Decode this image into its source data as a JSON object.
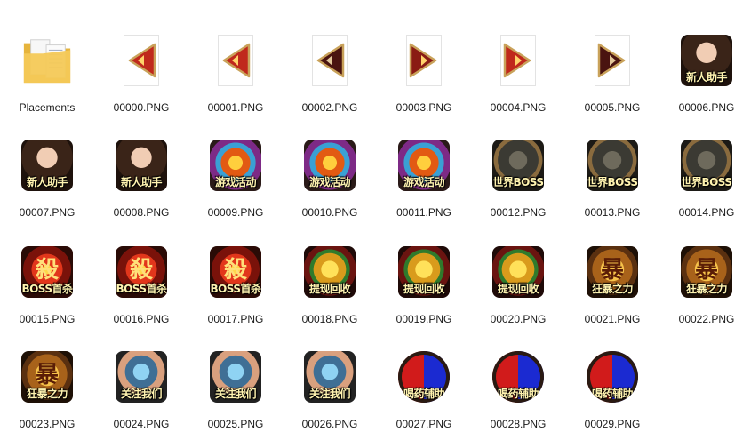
{
  "items": [
    {
      "name": "Placements",
      "kind": "folder"
    },
    {
      "name": "00000.PNG",
      "kind": "arrow",
      "dir": "left",
      "tone": "bright"
    },
    {
      "name": "00001.PNG",
      "kind": "arrow",
      "dir": "left",
      "tone": "bright"
    },
    {
      "name": "00002.PNG",
      "kind": "arrow",
      "dir": "left",
      "tone": "dark"
    },
    {
      "name": "00003.PNG",
      "kind": "arrow",
      "dir": "right",
      "tone": "mid"
    },
    {
      "name": "00004.PNG",
      "kind": "arrow",
      "dir": "right",
      "tone": "bright"
    },
    {
      "name": "00005.PNG",
      "kind": "arrow",
      "dir": "right",
      "tone": "dark"
    },
    {
      "name": "00006.PNG",
      "kind": "icon",
      "theme": "woman",
      "label": "新人助手"
    },
    {
      "name": "00007.PNG",
      "kind": "icon",
      "theme": "woman",
      "label": "新人助手"
    },
    {
      "name": "00008.PNG",
      "kind": "icon",
      "theme": "woman",
      "label": "新人助手"
    },
    {
      "name": "00009.PNG",
      "kind": "icon",
      "theme": "game",
      "label": "游戏活动"
    },
    {
      "name": "00010.PNG",
      "kind": "icon",
      "theme": "game",
      "label": "游戏活动"
    },
    {
      "name": "00011.PNG",
      "kind": "icon",
      "theme": "game",
      "label": "游戏活动"
    },
    {
      "name": "00012.PNG",
      "kind": "icon",
      "theme": "boss",
      "label": "世界BOSS"
    },
    {
      "name": "00013.PNG",
      "kind": "icon",
      "theme": "boss",
      "label": "世界BOSS"
    },
    {
      "name": "00014.PNG",
      "kind": "icon",
      "theme": "boss",
      "label": "世界BOSS"
    },
    {
      "name": "00015.PNG",
      "kind": "icon",
      "theme": "kill",
      "label": "BOSS首杀"
    },
    {
      "name": "00016.PNG",
      "kind": "icon",
      "theme": "kill",
      "label": "BOSS首杀"
    },
    {
      "name": "00017.PNG",
      "kind": "icon",
      "theme": "kill",
      "label": "BOSS首杀"
    },
    {
      "name": "00018.PNG",
      "kind": "icon",
      "theme": "gold",
      "label": "提现回收"
    },
    {
      "name": "00019.PNG",
      "kind": "icon",
      "theme": "gold",
      "label": "提现回收"
    },
    {
      "name": "00020.PNG",
      "kind": "icon",
      "theme": "gold",
      "label": "提现回收"
    },
    {
      "name": "00021.PNG",
      "kind": "icon",
      "theme": "rage",
      "label": "狂暴之力"
    },
    {
      "name": "00022.PNG",
      "kind": "icon",
      "theme": "rage",
      "label": "狂暴之力"
    },
    {
      "name": "00023.PNG",
      "kind": "icon",
      "theme": "rage",
      "label": "狂暴之力"
    },
    {
      "name": "00024.PNG",
      "kind": "icon",
      "theme": "phone",
      "label": "关注我们"
    },
    {
      "name": "00025.PNG",
      "kind": "icon",
      "theme": "phone",
      "label": "关注我们"
    },
    {
      "name": "00026.PNG",
      "kind": "icon",
      "theme": "phone",
      "label": "关注我们"
    },
    {
      "name": "00027.PNG",
      "kind": "icon",
      "theme": "potion",
      "label": "喝药辅助"
    },
    {
      "name": "00028.PNG",
      "kind": "icon",
      "theme": "potion",
      "label": "喝药辅助"
    },
    {
      "name": "00029.PNG",
      "kind": "icon",
      "theme": "potion",
      "label": "喝药辅助"
    }
  ],
  "rage_glyph": "暴",
  "kill_glyph": "殺",
  "colors": {
    "folder": "#f4c957",
    "folder_dark": "#e6b43c",
    "caption": "#1a1a1a",
    "icon_text": "#fff3b0"
  }
}
